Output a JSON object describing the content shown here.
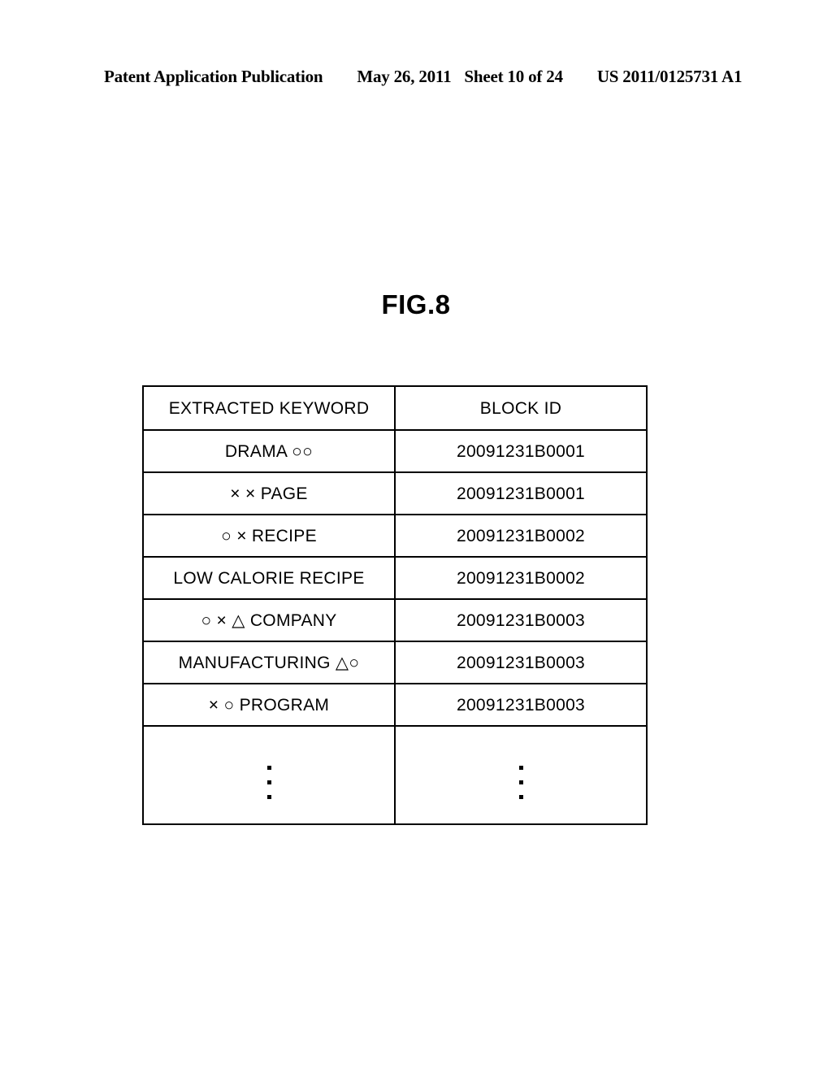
{
  "header": {
    "publication": "Patent Application Publication",
    "date": "May 26, 2011",
    "sheet": "Sheet 10 of 24",
    "number": "US 2011/0125731 A1"
  },
  "figure": {
    "title": "FIG.8"
  },
  "table": {
    "columns": [
      {
        "key": "keyword",
        "label": "EXTRACTED KEYWORD"
      },
      {
        "key": "block_id",
        "label": "BLOCK ID"
      }
    ],
    "rows": [
      {
        "keyword": "DRAMA ○○",
        "block_id": "20091231B0001"
      },
      {
        "keyword": "× × PAGE",
        "block_id": "20091231B0001"
      },
      {
        "keyword": "○ × RECIPE",
        "block_id": "20091231B0002"
      },
      {
        "keyword": "LOW CALORIE RECIPE",
        "block_id": "20091231B0002"
      },
      {
        "keyword": "○ × △ COMPANY",
        "block_id": "20091231B0003"
      },
      {
        "keyword": "MANUFACTURING △○",
        "block_id": "20091231B0003"
      },
      {
        "keyword": "× ○ PROGRAM",
        "block_id": "20091231B0003"
      }
    ],
    "continuation": {
      "keyword": "⋮",
      "block_id": "⋮"
    }
  },
  "colors": {
    "ink": "#000000",
    "paper": "#ffffff"
  }
}
